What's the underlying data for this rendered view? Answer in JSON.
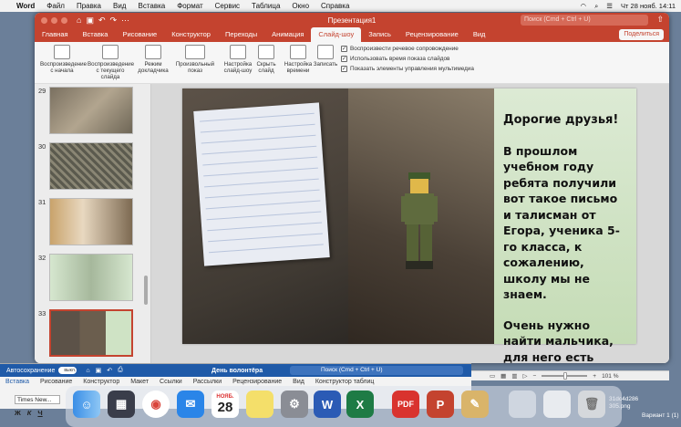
{
  "menubar": {
    "app": "Word",
    "items": [
      "Файл",
      "Правка",
      "Вид",
      "Вставка",
      "Формат",
      "Сервис",
      "Таблица",
      "Окно",
      "Справка"
    ],
    "datetime": "Чт 28 нояб. 14:11"
  },
  "ppt": {
    "title": "Презентация1",
    "search_placeholder": "Поиск (Cmd + Ctrl + U)",
    "tabs": [
      "Главная",
      "Вставка",
      "Рисование",
      "Конструктор",
      "Переходы",
      "Анимация",
      "Слайд-шоу",
      "Запись",
      "Рецензирование",
      "Вид"
    ],
    "active_tab": "Слайд-шоу",
    "share_label": "Поделиться",
    "ribbon": {
      "btn1": "Воспроизведение с начала",
      "btn2": "Воспроизведение с текущего слайда",
      "btn3": "Режим докладчика",
      "btn4": "Произвольный показ",
      "btn5": "Настройка слайд-шоу",
      "btn6": "Скрыть слайд",
      "btn7": "Настройка времени",
      "btn8": "Записать",
      "chk1": "Воспроизвести речевое сопровождение",
      "chk2": "Использовать время показа слайдов",
      "chk3": "Показать элементы управления мультимедиа"
    },
    "slides": [
      "29",
      "30",
      "31",
      "32",
      "33"
    ],
    "selected_slide": "33",
    "slide_text": {
      "heading": "Дорогие друзья!",
      "para1": "В прошлом учебном году ребята получили вот такое письмо и талисман от Егора, ученика 5-го класса, к сожалению, школу мы не знаем.",
      "para2": "Очень нужно найти мальчика, для него есть обратная связь"
    },
    "zoom": "101 %"
  },
  "word": {
    "autosave": "Автосохранение",
    "autosave_state": "выкл.",
    "doc_title": "День волонтёра",
    "search_placeholder": "Поиск (Cmd + Ctrl + U)",
    "tabs": [
      "Вставка",
      "Рисование",
      "Конструктор",
      "Макет",
      "Ссылки",
      "Рассылки",
      "Рецензирование",
      "Вид",
      "Конструктор таблиц"
    ],
    "share_label": "Поделиться",
    "font": "Times New...",
    "fmt_bold": "Ж",
    "fmt_italic": "К",
    "fmt_underline": "Ч"
  },
  "dock": {
    "calendar_month": "НОЯБ.",
    "calendar_day": "28"
  },
  "desktop": {
    "right_label": "ен\n-16\n.41",
    "file1": "31dc4d286",
    "file1b": "305.png",
    "file2": "Вариант 1 (1)"
  }
}
